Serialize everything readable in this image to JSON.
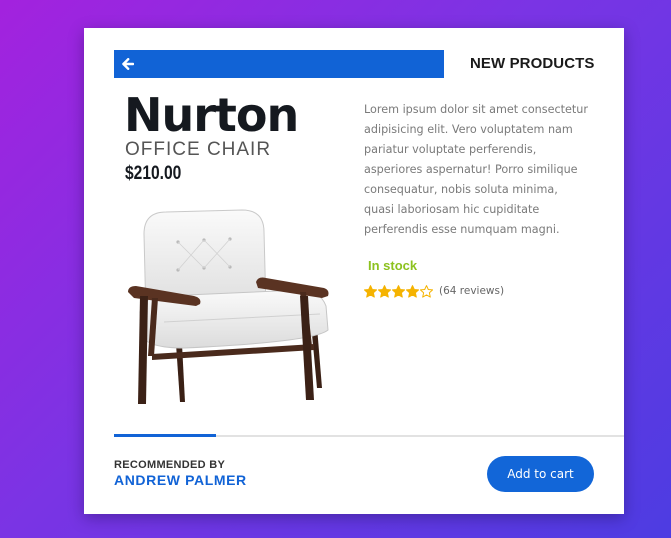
{
  "header": {
    "section_title": "NEW PRODUCTS",
    "back_icon": "arrow-left-icon"
  },
  "product": {
    "name": "Nurton",
    "subtitle": "OFFICE CHAIR",
    "price": "$210.00",
    "image": "office-chair-image",
    "description": "Lorem ipsum dolor sit amet consectetur adipisicing elit. Vero voluptatem nam pariatur voluptate perferendis, asperiores aspernatur! Porro similique consequatur, nobis soluta minima, quasi laboriosam hic cupiditate perferendis esse numquam magni.",
    "stock_status": "In stock",
    "rating": {
      "value": 4,
      "max": 5,
      "reviews_text": "(64 reviews)"
    }
  },
  "progress": {
    "fraction": 0.2
  },
  "footer": {
    "recommended_label": "RECOMMENDED BY",
    "recommender_name": "ANDREW PALMER",
    "add_to_cart_label": "Add to cart"
  },
  "colors": {
    "accent": "#1163d6",
    "stock": "#8dc21f",
    "star": "#f5b301",
    "background_start": "#a322de",
    "background_end": "#4d3ce2"
  }
}
